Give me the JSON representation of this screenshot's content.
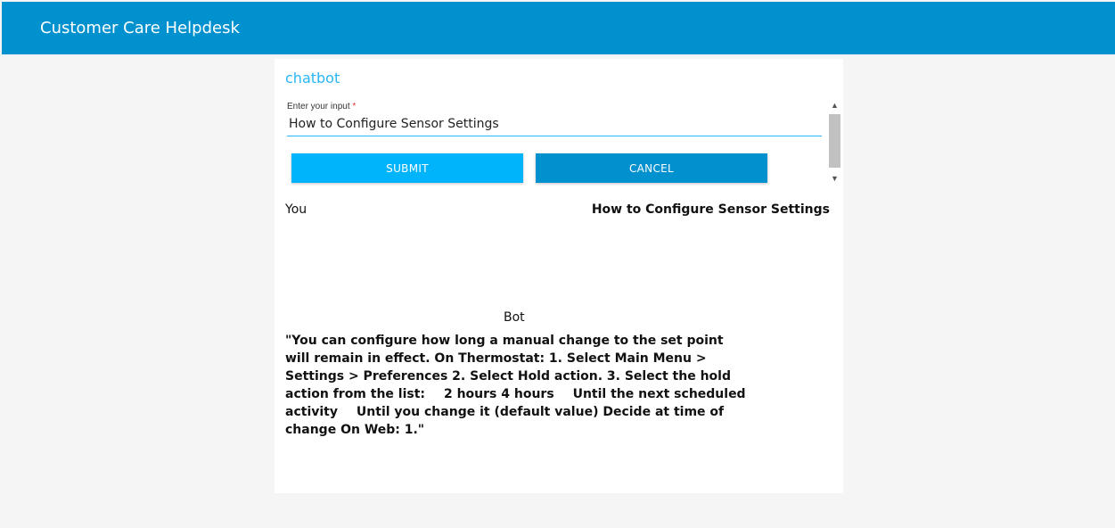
{
  "header": {
    "title": "Customer Care Helpdesk",
    "background": "#0091ce"
  },
  "chat_card": {
    "title": "chatbot",
    "title_color": "#29b6f6",
    "input": {
      "label": "Enter your input",
      "required_mark": "*",
      "value": "How to Configure Sensor Settings",
      "underline_color": "#29b6f6"
    },
    "scrollbar": {
      "up_icon": "chevron-up-icon",
      "down_icon": "chevron-down-icon"
    },
    "buttons": {
      "submit_label": "SUBMIT",
      "submit_color": "#00b4fc",
      "cancel_label": "CANCEL",
      "cancel_color": "#0091ce"
    },
    "conversation": {
      "user_label": "You",
      "user_message": "How to Configure Sensor Settings",
      "bot_label": "Bot",
      "bot_message": "\"You can configure how long a manual change to the set point will remain in effect. On Thermostat: 1. Select Main Menu > Settings > Preferences 2. Select Hold action. 3. Select the hold action from the list:  2 hours 4 hours  Until the next scheduled activity  Until you change it (default value) Decide at time of change On Web: 1.\""
    }
  }
}
